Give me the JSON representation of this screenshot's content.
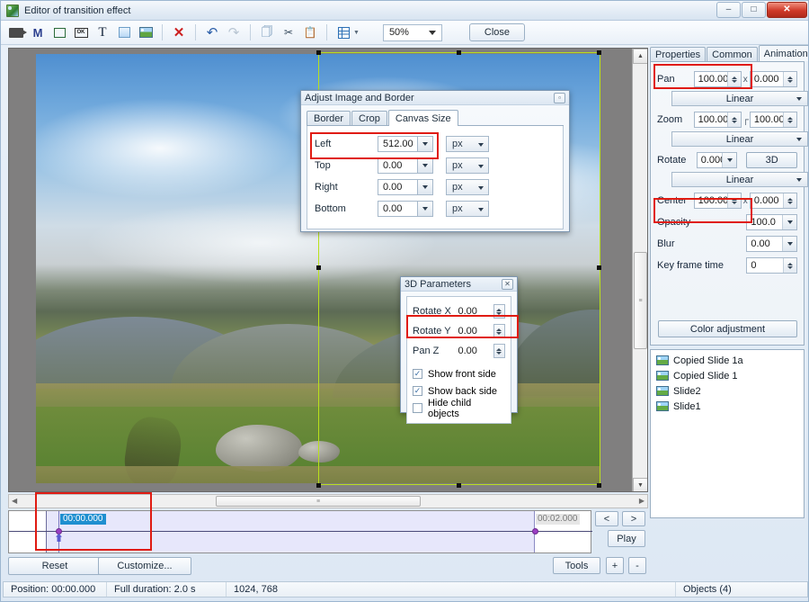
{
  "window": {
    "title": "Editor of transition effect",
    "minimize": "–",
    "maximize": "□",
    "close": "✕"
  },
  "toolbar": {
    "icons": [
      {
        "name": "camera-icon",
        "label": "camera"
      },
      {
        "name": "mask-icon",
        "label": "M"
      },
      {
        "name": "frame-icon",
        "label": "frame"
      },
      {
        "name": "button-icon",
        "label": "OK"
      },
      {
        "name": "text-icon",
        "label": "T"
      },
      {
        "name": "rectangle-icon",
        "label": "rectangle"
      },
      {
        "name": "image-icon",
        "label": "image"
      }
    ],
    "delete_label": "✕",
    "undo_label": "↶",
    "redo_label": "↷",
    "copy_label": "copy",
    "cut_label": "cut",
    "paste_label": "paste",
    "grid_label": "grid",
    "zoom_value": "50%",
    "close_button": "Close"
  },
  "dialog_adjust": {
    "title": "Adjust Image and Border",
    "close_glyph": "▫",
    "tabs": [
      "Border",
      "Crop",
      "Canvas Size"
    ],
    "active_tab": "Canvas Size",
    "rows": [
      {
        "label": "Left",
        "value": "512.00",
        "unit": "px"
      },
      {
        "label": "Top",
        "value": "0.00",
        "unit": "px"
      },
      {
        "label": "Right",
        "value": "0.00",
        "unit": "px"
      },
      {
        "label": "Bottom",
        "value": "0.00",
        "unit": "px"
      }
    ]
  },
  "dialog_3d": {
    "title": "3D Parameters",
    "close_glyph": "✕",
    "rows": [
      {
        "label": "Rotate X",
        "value": "0.00"
      },
      {
        "label": "Rotate Y",
        "value": "0.00"
      },
      {
        "label": "Pan Z",
        "value": "0.00"
      }
    ],
    "checks": [
      {
        "label": "Show front side",
        "checked": true,
        "mark": "✓"
      },
      {
        "label": "Show back side",
        "checked": true,
        "mark": "✓"
      },
      {
        "label": "Hide child objects",
        "checked": false,
        "mark": ""
      }
    ]
  },
  "right_panel": {
    "tabs": [
      "Properties",
      "Common",
      "Animation"
    ],
    "active_tab": "Animation",
    "pan": {
      "label": "Pan",
      "x": "100.000",
      "sep": "x",
      "y": "0.000",
      "easing": "Linear"
    },
    "zoom": {
      "label": "Zoom",
      "x": "100.000",
      "sep": "┌",
      "y": "100.000",
      "easing": "Linear"
    },
    "rotate": {
      "label": "Rotate",
      "value": "0.000",
      "button3d": "3D",
      "easing": "Linear"
    },
    "center": {
      "label": "Center",
      "x": "100.000",
      "sep": "x",
      "y": "0.000"
    },
    "opacity": {
      "label": "Opacity",
      "value": "100.0"
    },
    "blur": {
      "label": "Blur",
      "value": "0.00"
    },
    "keyframe": {
      "label": "Key frame time",
      "value": "0"
    },
    "color_adjustment": "Color adjustment",
    "objects": [
      {
        "label": "Copied Slide 1a"
      },
      {
        "label": "Copied Slide 1"
      },
      {
        "label": "Slide2"
      },
      {
        "label": "Slide1"
      }
    ]
  },
  "timeline": {
    "current_time": "00:00.000",
    "end_time": "00:02.000",
    "prev_label": "<",
    "next_label": ">",
    "play_label": "Play",
    "tools_label": "Tools",
    "plus_label": "+",
    "minus_label": "-",
    "reset_label": "Reset",
    "customize_label": "Customize..."
  },
  "status": {
    "position": "Position:  00:00.000",
    "duration": "Full duration:  2.0 s",
    "size": "1024, 768",
    "objects": "Objects (4)"
  },
  "colors": {
    "highlight": "#e01b12",
    "selection": "#b9e01b",
    "accent": "#1f8fd0"
  }
}
